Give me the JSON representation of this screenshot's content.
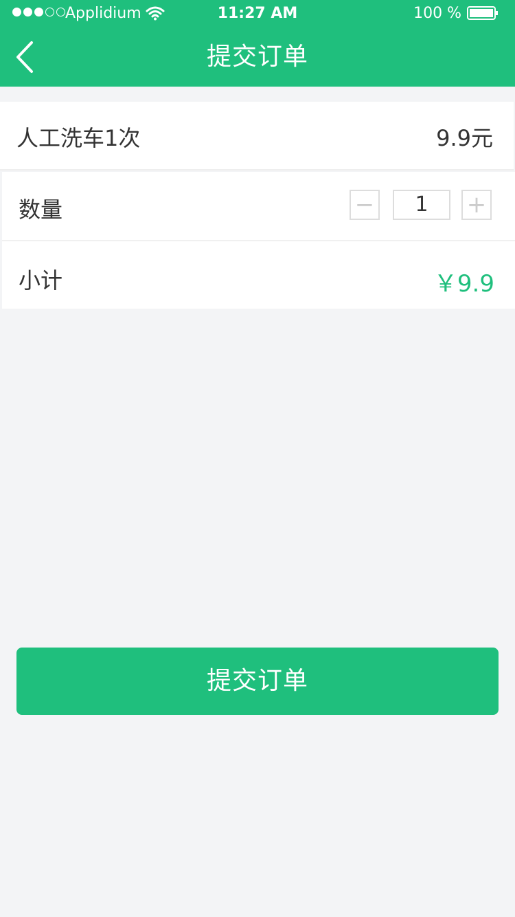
{
  "status_bar": {
    "carrier": "Applidium",
    "time": "11:27 AM",
    "battery_percent": "100 %",
    "signal_level": 3,
    "signal_max": 5
  },
  "nav": {
    "title": "提交订单",
    "back_icon": "chevron-left-icon"
  },
  "order": {
    "product_name": "人工洗车1次",
    "product_price": "9.9元",
    "quantity_label": "数量",
    "quantity_value": "1",
    "minus_symbol": "−",
    "plus_symbol": "+",
    "subtotal_label": "小计",
    "subtotal_value": "￥9.9"
  },
  "submit_button": {
    "label": "提交订单"
  },
  "theme": {
    "primary": "#1fbf7d",
    "background": "#f3f4f6",
    "text": "#333333"
  }
}
